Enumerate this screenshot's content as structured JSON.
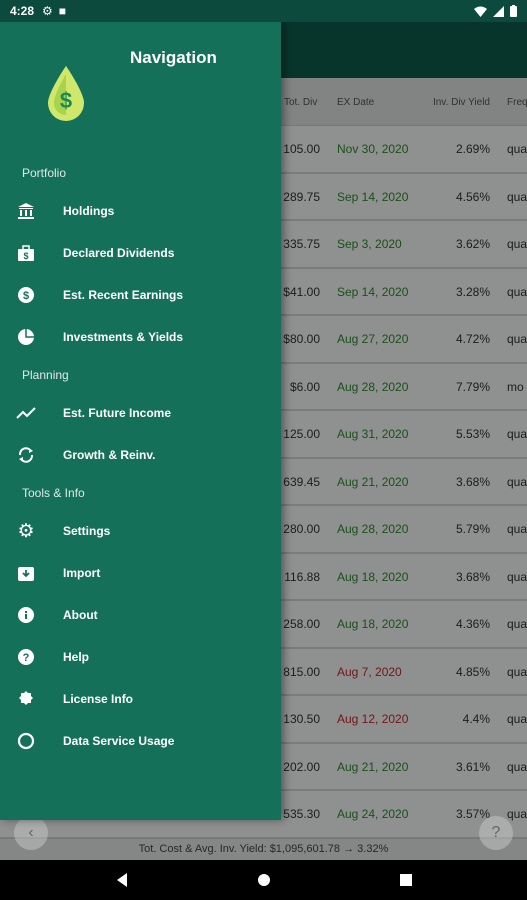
{
  "status_bar": {
    "time": "4:28"
  },
  "drawer": {
    "title": "Navigation",
    "sections": {
      "portfolio": "Portfolio",
      "planning": "Planning",
      "tools": "Tools & Info"
    },
    "items": {
      "holdings": "Holdings",
      "declared_dividends": "Declared Dividends",
      "est_recent_earnings": "Est. Recent Earnings",
      "investments_yields": "Investments & Yields",
      "est_future_income": "Est. Future Income",
      "growth_reinv": "Growth & Reinv.",
      "settings": "Settings",
      "import": "Import",
      "about": "About",
      "help": "Help",
      "license_info": "License Info",
      "data_service_usage": "Data Service Usage"
    }
  },
  "table": {
    "headers": {
      "tot_div": "Tot. Div",
      "ex_date": "EX Date",
      "inv_div_yield": "Inv. Div Yield",
      "freq": "Freq"
    },
    "rows": [
      {
        "tot": "105.00",
        "date": "Nov 30, 2020",
        "yield": "2.69%",
        "freq": "qua"
      },
      {
        "tot": "289.75",
        "date": "Sep 14, 2020",
        "yield": "4.56%",
        "freq": "qua"
      },
      {
        "tot": "335.75",
        "date": "Sep 3, 2020",
        "yield": "3.62%",
        "freq": "qua"
      },
      {
        "tot": "$41.00",
        "date": "Sep 14, 2020",
        "yield": "3.28%",
        "freq": "qua"
      },
      {
        "tot": "$80.00",
        "date": "Aug 27, 2020",
        "yield": "4.72%",
        "freq": "qua"
      },
      {
        "tot": "$6.00",
        "date": "Aug 28, 2020",
        "yield": "7.79%",
        "freq": "mo"
      },
      {
        "tot": "125.00",
        "date": "Aug 31, 2020",
        "yield": "5.53%",
        "freq": "qua"
      },
      {
        "tot": "639.45",
        "date": "Aug 21, 2020",
        "yield": "3.68%",
        "freq": "qua"
      },
      {
        "tot": "280.00",
        "date": "Aug 28, 2020",
        "yield": "5.79%",
        "freq": "qua"
      },
      {
        "tot": "116.88",
        "date": "Aug 18, 2020",
        "yield": "3.68%",
        "freq": "qua"
      },
      {
        "tot": "258.00",
        "date": "Aug 18, 2020",
        "yield": "4.36%",
        "freq": "qua"
      },
      {
        "tot": "815.00",
        "date": "Aug 7, 2020",
        "yield": "4.85%",
        "freq": "qua"
      },
      {
        "tot": "130.50",
        "date": "Aug 12, 2020",
        "yield": "4.4%",
        "freq": "qua"
      },
      {
        "tot": "202.00",
        "date": "Aug 21, 2020",
        "yield": "3.61%",
        "freq": "qua"
      },
      {
        "tot": "535.30",
        "date": "Aug 24, 2020",
        "yield": "3.57%",
        "freq": "qua"
      }
    ],
    "row_date_status": [
      "green",
      "green",
      "green",
      "green",
      "green",
      "green",
      "green",
      "green",
      "green",
      "green",
      "green",
      "red",
      "red",
      "green",
      "green"
    ]
  },
  "footer": {
    "text": "Tot. Cost & Avg. Inv. Yield: $1,095,601.78 → 3.32%"
  },
  "colors": {
    "drawer_bg": "#15705a",
    "toolbar_bg": "#0d5c4a",
    "date_green": "#2e8b2e",
    "date_red": "#c62828"
  },
  "icons": {
    "holdings": "bank-icon",
    "declared_dividends": "briefcase-icon",
    "est_recent_earnings": "dollar-coin-icon",
    "investments_yields": "pie-chart-icon",
    "est_future_income": "trending-up-icon",
    "growth_reinv": "refresh-icon",
    "settings": "gear-icon",
    "import": "import-icon",
    "about": "info-icon",
    "help": "help-icon",
    "license_info": "badge-icon",
    "data_service_usage": "ring-icon"
  }
}
